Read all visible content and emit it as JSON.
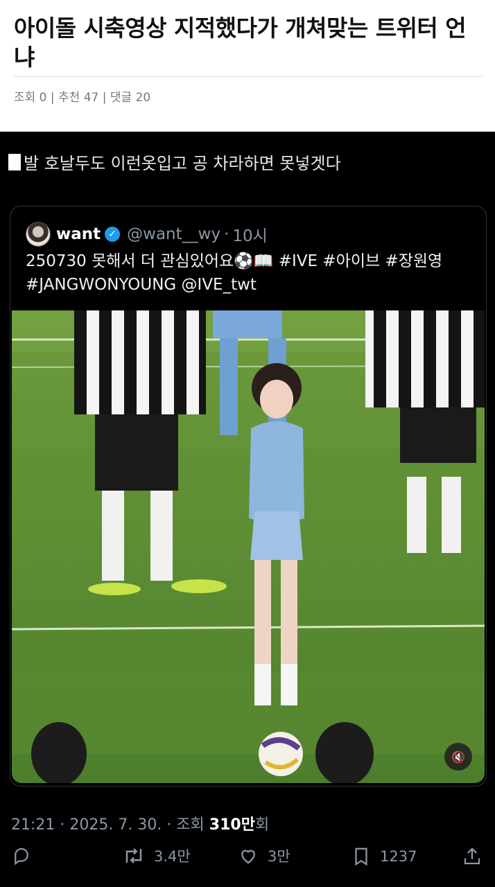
{
  "post": {
    "title": "아이돌 시축영상 지적했다가 개쳐맞는 트위터 언냐",
    "meta": "조회 0 | 추천 47 | 댓글 20"
  },
  "tweet": {
    "caption": "발 호날두도 이런옷입고 공 차라하면 못넣겟다",
    "quote": {
      "author_name": "want",
      "handle": "@want__wy",
      "separator": "·",
      "time": "10시",
      "text": "250730 못해서 더 관심있어요⚽📖 #IVE #아이브 #장원영 #JANGWONYOUNG @IVE_twt"
    },
    "media": {
      "type": "video",
      "description_icons": [
        "mute-icon"
      ],
      "mute_label": "🔇"
    },
    "timestamp": "21:21 · 2025. 7. 30. · 조회 ",
    "views": "310만",
    "views_suffix": "회",
    "actions": {
      "retweets": "3.4만",
      "likes": "3만",
      "bookmarks": "1237"
    }
  },
  "colors": {
    "background_dark": "#000000",
    "verified": "#1d9bf0",
    "muted_text": "#8b98a5"
  }
}
